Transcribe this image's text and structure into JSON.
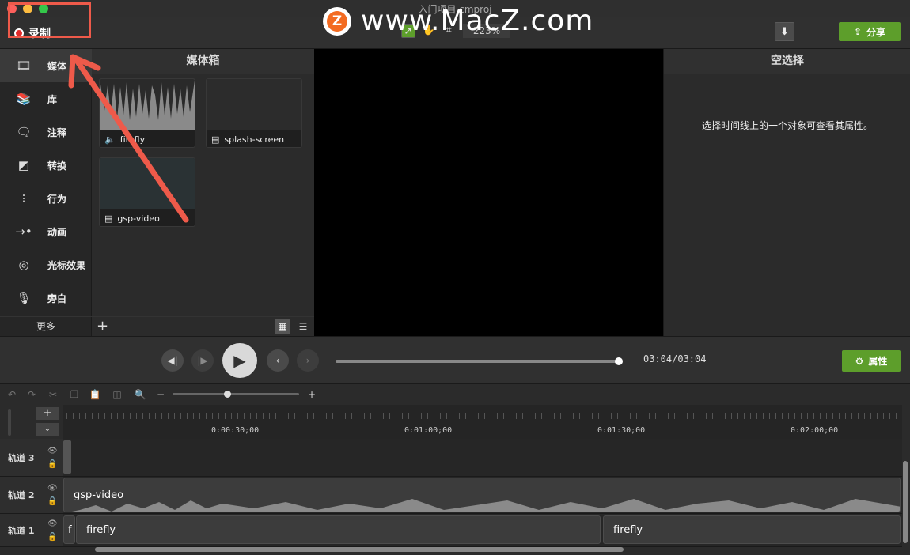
{
  "window": {
    "title": "入门项目.cmproj"
  },
  "toolbar": {
    "record_label": "录制",
    "zoom": "223%",
    "share_label": "分享"
  },
  "watermark": {
    "logo_letter": "Z",
    "text": "www.MacZ.com"
  },
  "sidebar": {
    "items": [
      {
        "label": "媒体",
        "icon": "media-icon"
      },
      {
        "label": "库",
        "icon": "library-icon"
      },
      {
        "label": "注释",
        "icon": "annotation-icon"
      },
      {
        "label": "转换",
        "icon": "transition-icon"
      },
      {
        "label": "行为",
        "icon": "behavior-icon"
      },
      {
        "label": "动画",
        "icon": "animation-icon"
      },
      {
        "label": "光标效果",
        "icon": "cursor-effect-icon"
      },
      {
        "label": "旁白",
        "icon": "microphone-icon"
      }
    ],
    "more_label": "更多"
  },
  "media_bin": {
    "title": "媒体箱",
    "items": [
      {
        "name": "firefly",
        "kind": "audio"
      },
      {
        "name": "splash-screen",
        "kind": "video"
      },
      {
        "name": "gsp-video",
        "kind": "video"
      }
    ]
  },
  "properties": {
    "title": "空选择",
    "message": "选择时间线上的一个对象可查看其属性。",
    "button_label": "属性"
  },
  "playback": {
    "timecode": "03:04/03:04",
    "progress": 1.0
  },
  "timeline": {
    "ruler_labels": [
      "0:00:30;00",
      "0:01:00;00",
      "0:01:30;00",
      "0:02:00;00"
    ],
    "tracks": [
      {
        "name": "轨道 3",
        "clips": []
      },
      {
        "name": "轨道 2",
        "clips": [
          {
            "label": "gsp-video"
          }
        ]
      },
      {
        "name": "轨道 1",
        "clips": [
          {
            "label": "f"
          },
          {
            "label": "firefly"
          },
          {
            "label": "firefly"
          }
        ]
      }
    ]
  },
  "colors": {
    "accent_green": "#5d9e2b",
    "record_red": "#e02a2a",
    "annotation_red": "#ee5a4a"
  }
}
